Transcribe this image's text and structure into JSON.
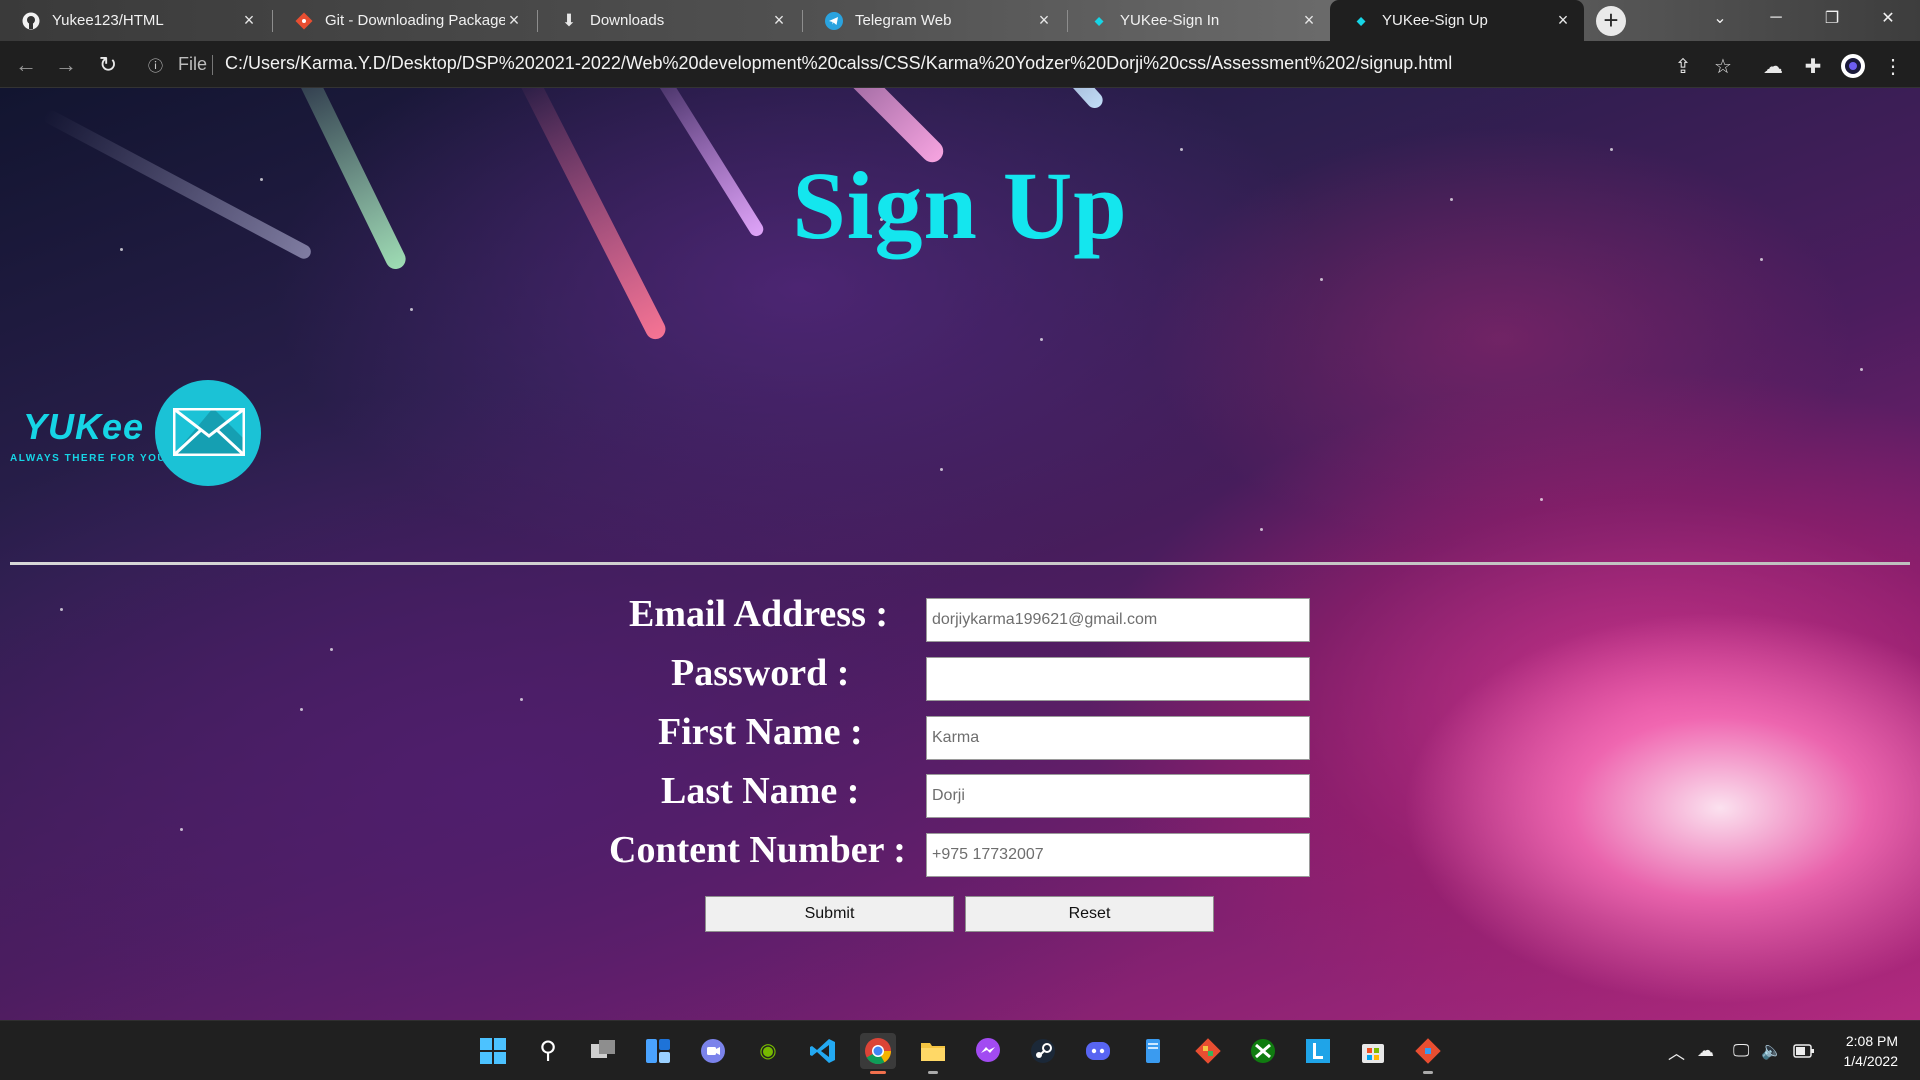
{
  "browser": {
    "tabs": [
      {
        "title": "Yukee123/HTML",
        "icon": "github-icon"
      },
      {
        "title": "Git - Downloading Package",
        "icon": "git-icon"
      },
      {
        "title": "Downloads",
        "icon": "download-icon"
      },
      {
        "title": "Telegram Web",
        "icon": "telegram-icon"
      },
      {
        "title": "YUKee-Sign In",
        "icon": "yukee-icon"
      },
      {
        "title": "YUKee-Sign Up",
        "icon": "yukee-icon",
        "active": true
      }
    ],
    "address_label": "File",
    "url": "C:/Users/Karma.Y.D/Desktop/DSP%202021-2022/Web%20development%20calss/CSS/Karma%20Yodzer%20Dorji%20css/Assessment%202/signup.html"
  },
  "page": {
    "title": "Sign Up",
    "logo": {
      "wordmark": "YUKee",
      "tagline": "ALWAYS THERE FOR YOU",
      "accent": "#16d5e6"
    },
    "form": {
      "email_label": "Email Address :",
      "email_value": "dorjiykarma199621@gmail.com",
      "password_label": "Password :",
      "password_value": "",
      "first_name_label": "First Name :",
      "first_name_value": "Karma",
      "last_name_label": "Last Name :",
      "last_name_value": "Dorji",
      "contact_label": "Content Number :",
      "contact_value": "+975 17732007",
      "submit_label": "Submit",
      "reset_label": "Reset"
    }
  },
  "taskbar": {
    "apps": [
      "start",
      "search",
      "task-view",
      "widgets",
      "teams-chat",
      "nvidia",
      "vscode",
      "chrome",
      "file-explorer",
      "messenger",
      "steam",
      "discord",
      "notepad",
      "git",
      "xbox",
      "libreoffice",
      "microsoft-store",
      "git-gui"
    ],
    "time": "2:08 PM",
    "date": "1/4/2022"
  },
  "colors": {
    "title": "#14e6ee",
    "page_background": "#4b1d5e",
    "taskbar": "#202020"
  }
}
